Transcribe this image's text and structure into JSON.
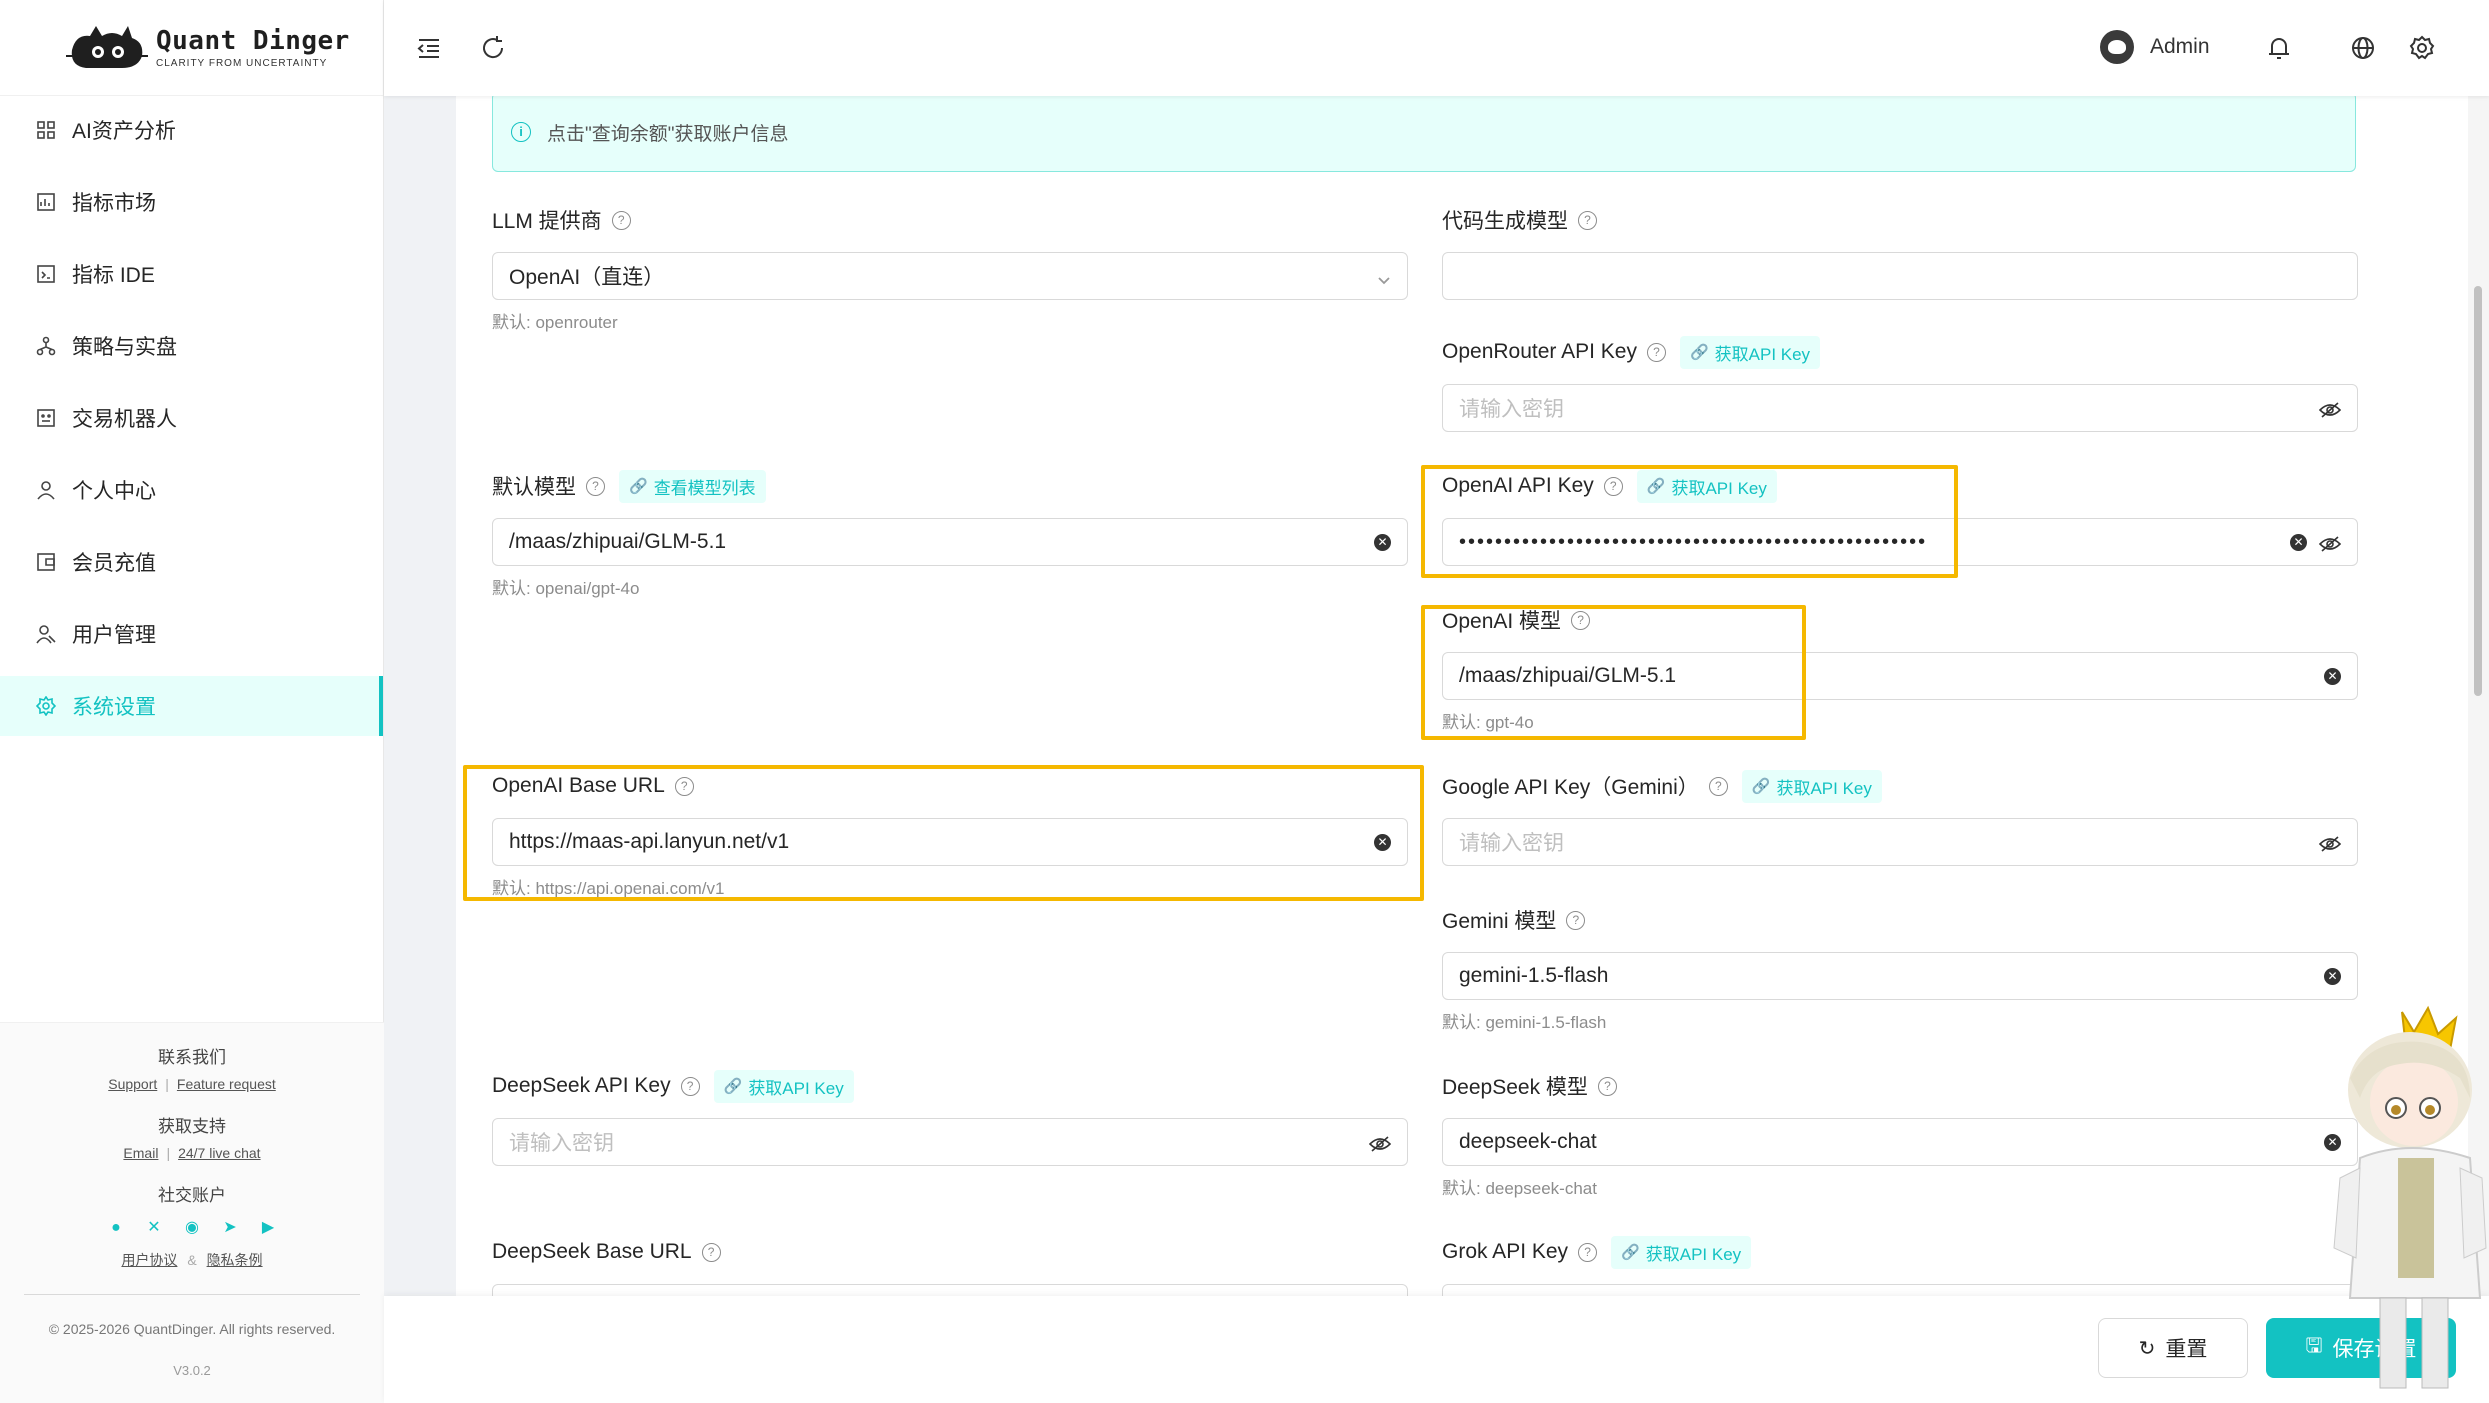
{
  "brand": {
    "name": "Quant Dinger",
    "tagline": "CLARITY FROM UNCERTAINTY"
  },
  "sidebar": {
    "items": [
      {
        "label": "AI资产分析",
        "icon": "grid-icon"
      },
      {
        "label": "指标市场",
        "icon": "chart-icon"
      },
      {
        "label": "指标 IDE",
        "icon": "code-icon"
      },
      {
        "label": "策略与实盘",
        "icon": "network-icon"
      },
      {
        "label": "交易机器人",
        "icon": "robot-icon"
      },
      {
        "label": "个人中心",
        "icon": "user-icon"
      },
      {
        "label": "会员充值",
        "icon": "wallet-icon"
      },
      {
        "label": "用户管理",
        "icon": "users-icon"
      },
      {
        "label": "系统设置",
        "icon": "gear-icon",
        "active": true
      }
    ],
    "footer": {
      "contact_title": "联系我们",
      "support_link": "Support",
      "feature_link": "Feature request",
      "get_support_title": "获取支持",
      "email_link": "Email",
      "live_chat_link": "24/7 live chat",
      "social_title": "社交账户",
      "terms_link": "用户协议",
      "amp": "&",
      "privacy_link": "隐私条例",
      "copyright": "© 2025-2026 QuantDinger. All rights reserved.",
      "version": "V3.0.2"
    }
  },
  "header": {
    "user_name": "Admin"
  },
  "alert": {
    "text": "点击\"查询余额\"获取账户信息"
  },
  "form": {
    "llm_provider": {
      "label": "LLM 提供商",
      "value": "OpenAI（直连）",
      "hint": "默认: openrouter"
    },
    "code_model": {
      "label": "代码生成模型",
      "value": ""
    },
    "openrouter_key": {
      "label": "OpenRouter API Key",
      "link": "获取API Key",
      "placeholder": "请输入密钥"
    },
    "default_model": {
      "label": "默认模型",
      "link": "查看模型列表",
      "value": "/maas/zhipuai/GLM-5.1",
      "hint": "默认: openai/gpt-4o"
    },
    "openai_key": {
      "label": "OpenAI API Key",
      "link": "获取API Key",
      "value": "••••••••••••••••••••••••••••••••••••••••••••••••••••"
    },
    "openai_model": {
      "label": "OpenAI 模型",
      "value": "/maas/zhipuai/GLM-5.1",
      "hint": "默认: gpt-4o"
    },
    "openai_base_url": {
      "label": "OpenAI Base URL",
      "value": "https://maas-api.lanyun.net/v1",
      "hint": "默认: https://api.openai.com/v1"
    },
    "google_key": {
      "label": "Google API Key（Gemini）",
      "link": "获取API Key",
      "placeholder": "请输入密钥"
    },
    "gemini_model": {
      "label": "Gemini 模型",
      "value": "gemini-1.5-flash",
      "hint": "默认: gemini-1.5-flash"
    },
    "deepseek_key": {
      "label": "DeepSeek API Key",
      "link": "获取API Key",
      "placeholder": "请输入密钥"
    },
    "deepseek_model": {
      "label": "DeepSeek 模型",
      "value": "deepseek-chat",
      "hint": "默认: deepseek-chat"
    },
    "deepseek_base_url": {
      "label": "DeepSeek Base URL"
    },
    "grok_key": {
      "label": "Grok API Key",
      "link": "获取API Key"
    }
  },
  "actions": {
    "reset_label": "重置",
    "save_label": "保存设置"
  },
  "colors": {
    "accent": "#13c2c2",
    "highlight": "#f5b800"
  }
}
